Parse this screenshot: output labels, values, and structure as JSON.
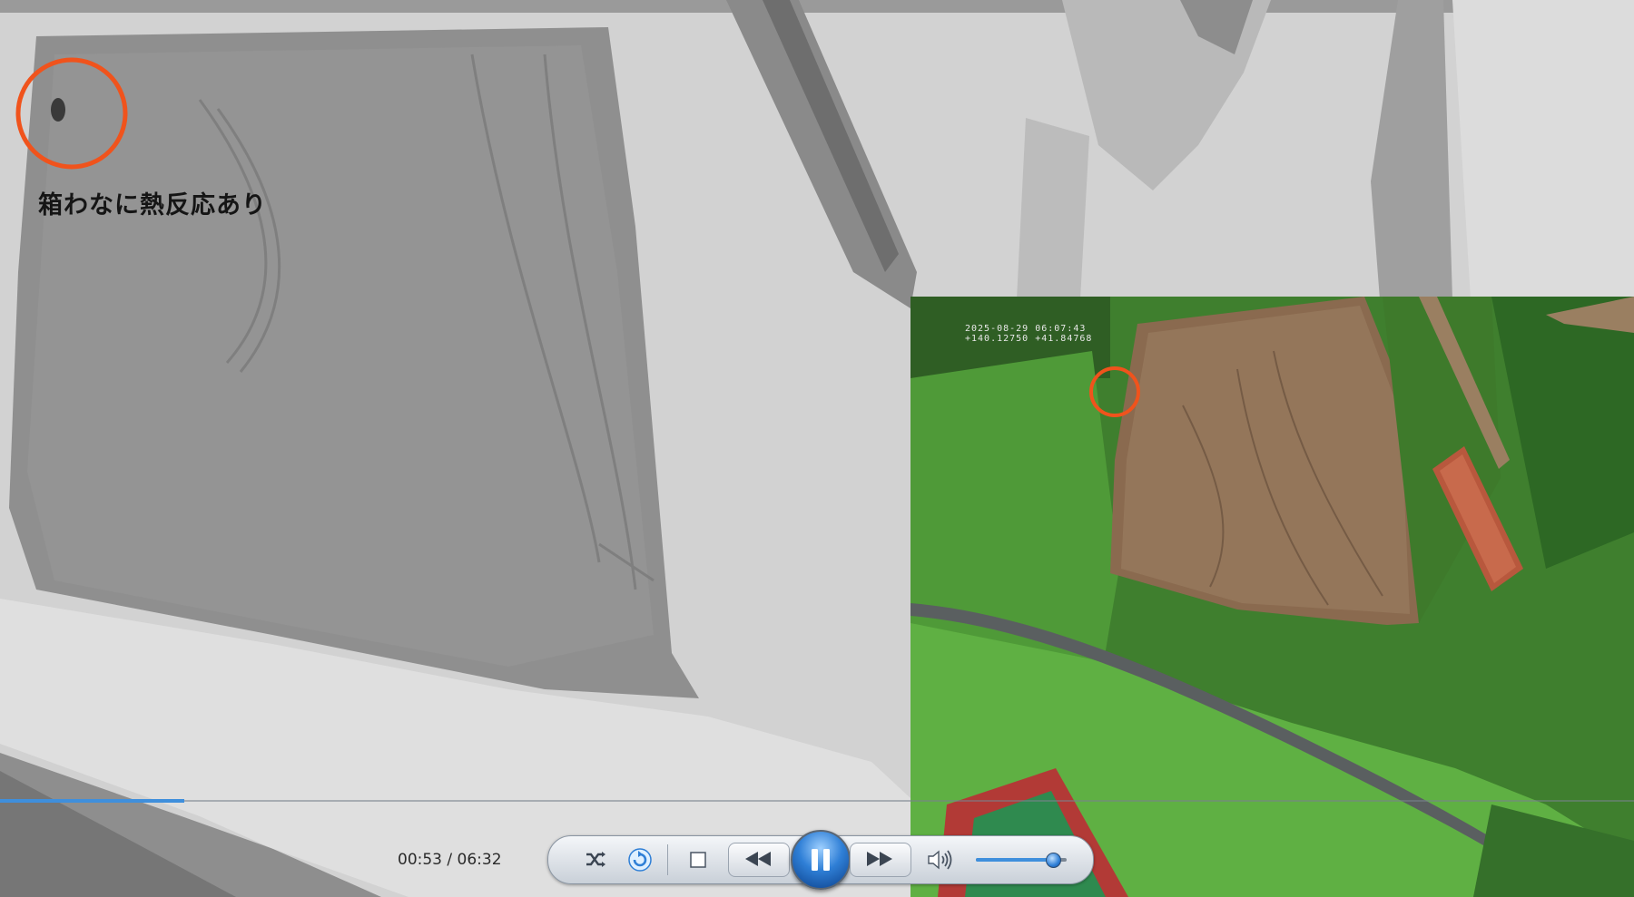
{
  "video": {
    "annotation_text": "箱わなに熱反応あり",
    "inset_osd_line1": "2025-08-29 06:07:43",
    "inset_osd_line2": "+140.12750 +41.84768",
    "annotation_color": "#f0531c"
  },
  "player": {
    "time_display": "00:53 / 06:32",
    "progress_percent": 11.3,
    "volume_percent": 85,
    "state": "playing",
    "accent_color": "#3f8fdc",
    "icons": {
      "shuffle": "shuffle-icon",
      "repeat": "repeat-icon",
      "stop": "stop-icon",
      "previous": "rewind-icon",
      "play_pause": "pause-icon",
      "next": "fast-forward-icon",
      "mute": "speaker-icon"
    }
  }
}
